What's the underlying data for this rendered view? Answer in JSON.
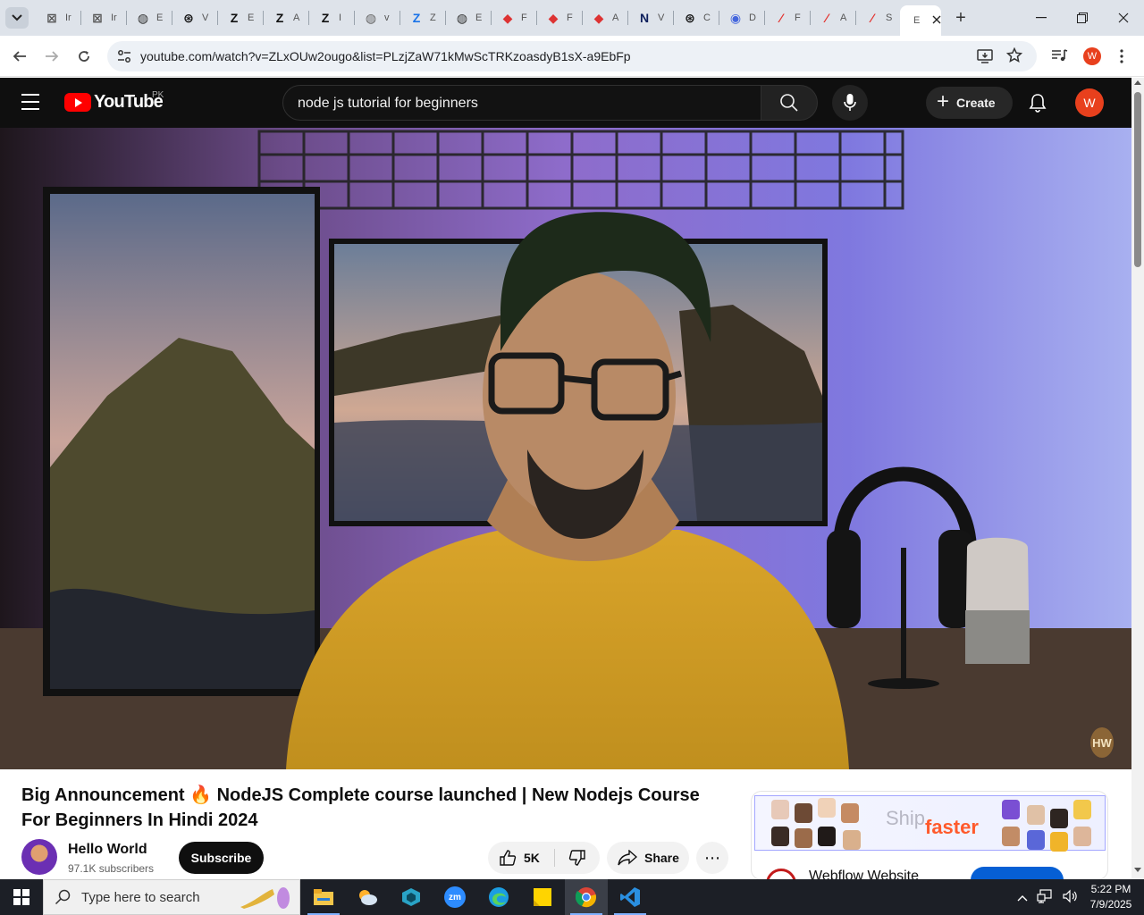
{
  "browser": {
    "tabs": [
      {
        "icon": "gmail-icon",
        "label": "Ir",
        "fav": "⊠",
        "color": "#555"
      },
      {
        "icon": "gmail-icon",
        "label": "Ir",
        "fav": "⊠",
        "color": "#555"
      },
      {
        "icon": "globe-icon",
        "label": "E",
        "fav": "◍",
        "color": "#333"
      },
      {
        "icon": "openai-icon",
        "label": "V",
        "fav": "⊛",
        "color": "#111"
      },
      {
        "icon": "z-icon",
        "label": "E",
        "fav": "Z",
        "color": "#111"
      },
      {
        "icon": "z-icon",
        "label": "A",
        "fav": "Z",
        "color": "#111"
      },
      {
        "icon": "z-icon",
        "label": "I",
        "fav": "Z",
        "color": "#111"
      },
      {
        "icon": "globe-icon",
        "label": "v",
        "fav": "◍",
        "color": "#666"
      },
      {
        "icon": "z-icon",
        "label": "Z",
        "fav": "Z",
        "color": "#1a73e8"
      },
      {
        "icon": "globe-icon",
        "label": "E",
        "fav": "◍",
        "color": "#333"
      },
      {
        "icon": "gem-icon",
        "label": "F",
        "fav": "◆",
        "color": "#d33"
      },
      {
        "icon": "gem-icon",
        "label": "F",
        "fav": "◆",
        "color": "#d33"
      },
      {
        "icon": "gem-icon",
        "label": "A",
        "fav": "◆",
        "color": "#d33"
      },
      {
        "icon": "n-icon",
        "label": "V",
        "fav": "N",
        "color": "#0d1f5c"
      },
      {
        "icon": "openai-icon",
        "label": "C",
        "fav": "⊛",
        "color": "#111"
      },
      {
        "icon": "copilot-icon",
        "label": "D",
        "fav": "◉",
        "color": "#4466dd"
      },
      {
        "icon": "acrobat-icon",
        "label": "F",
        "fav": "⁄",
        "color": "#e3312d"
      },
      {
        "icon": "acrobat-icon",
        "label": "A",
        "fav": "⁄",
        "color": "#e3312d"
      },
      {
        "icon": "acrobat-icon",
        "label": "S",
        "fav": "⁄",
        "color": "#e3312d"
      },
      {
        "icon": "youtube-icon",
        "label": "E",
        "fav": "",
        "color": "#333",
        "active": true
      }
    ],
    "new_tab_label": "+",
    "url": "youtube.com/watch?v=ZLxOUw2ougo&list=PLzjZaW71kMwScTRKzoasdyB1sX-a9EbFp",
    "profile_initial": "W",
    "colors": {
      "tabstrip": "#dee3ea",
      "profile": "#e8401d"
    }
  },
  "youtube": {
    "logo_text": "YouTube",
    "region": "PK",
    "search_query": "node js tutorial for beginners",
    "create_label": "Create",
    "avatar_initial": "W",
    "watermark": "HW",
    "video": {
      "title": "Big Announcement 🔥 NodeJS Complete course launched | New Nodejs Course For Beginners In Hindi 2024",
      "channel": "Hello World",
      "subscribers": "97.1K subscribers",
      "subscribe_label": "Subscribe",
      "likes": "5K",
      "share_label": "Share",
      "more_label": "⋯"
    },
    "ad": {
      "banner_word1": "Ship",
      "banner_word2": "faster",
      "title": "Webflow Website"
    }
  },
  "taskbar": {
    "search_placeholder": "Type here to search",
    "apps": [
      "file-explorer-icon",
      "weather-icon",
      "app-icon",
      "zoom-icon",
      "edge-icon",
      "sticky-notes-icon",
      "chrome-icon",
      "vscode-icon"
    ],
    "zoom_label": "zm",
    "time": "5:22 PM",
    "date": "7/9/2025"
  }
}
